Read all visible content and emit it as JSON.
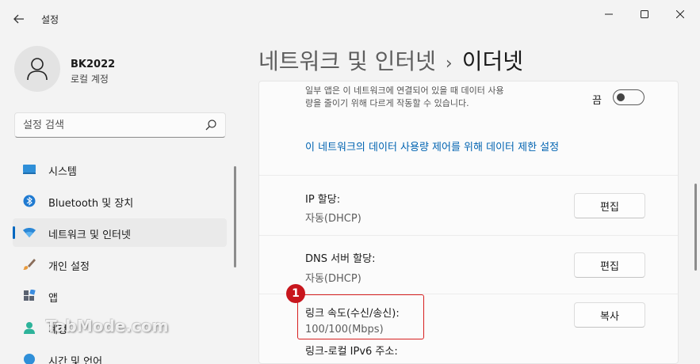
{
  "app": {
    "title": "설정",
    "back_icon": "back-arrow-icon"
  },
  "window_controls": {
    "minimize": "–",
    "maximize": "☐",
    "close": "✕"
  },
  "profile": {
    "name": "BK2022",
    "account_type": "로컬 계정"
  },
  "search": {
    "placeholder": "설정 검색"
  },
  "sidebar": {
    "items": [
      {
        "label": "시스템",
        "icon": "system-icon",
        "active": false
      },
      {
        "label": "Bluetooth 및 장치",
        "icon": "bluetooth-icon",
        "active": false
      },
      {
        "label": "네트워크 및 인터넷",
        "icon": "wifi-icon",
        "active": true
      },
      {
        "label": "개인 설정",
        "icon": "brush-icon",
        "active": false
      },
      {
        "label": "앱",
        "icon": "apps-icon",
        "active": false
      },
      {
        "label": "계정",
        "icon": "account-icon",
        "active": false
      },
      {
        "label": "시간 및 언어",
        "icon": "time-language-icon",
        "active": false
      }
    ]
  },
  "breadcrumb": {
    "parent": "네트워크 및 인터넷",
    "separator": "›",
    "current": "이더넷"
  },
  "metered": {
    "description": "일부 앱은 이 네트워크에 연결되어 있을 때 데이터 사용량을 줄이기 위해 다르게 작동할 수 있습니다.",
    "toggle_label": "끔",
    "toggle_on": false
  },
  "data_limit_link": "이 네트워크의 데이터 사용량 제어를 위해 데이터 제한 설정",
  "ip_assignment": {
    "label": "IP 할당:",
    "value": "자동(DHCP)",
    "button": "편집"
  },
  "dns_assignment": {
    "label": "DNS 서버 할당:",
    "value": "자동(DHCP)",
    "button": "편집"
  },
  "link_speed": {
    "label": "링크 속도(수신/송신):",
    "value": "100/100(Mbps)",
    "button": "복사"
  },
  "link_local_ipv6": {
    "label": "링크-로컬 IPv6 주소:"
  },
  "annotation": {
    "badge": "1",
    "color": "#c8161d"
  },
  "watermark": "TabMode.com",
  "colors": {
    "accent": "#0067c0",
    "link": "#0063b1",
    "highlight": "#d72020"
  }
}
